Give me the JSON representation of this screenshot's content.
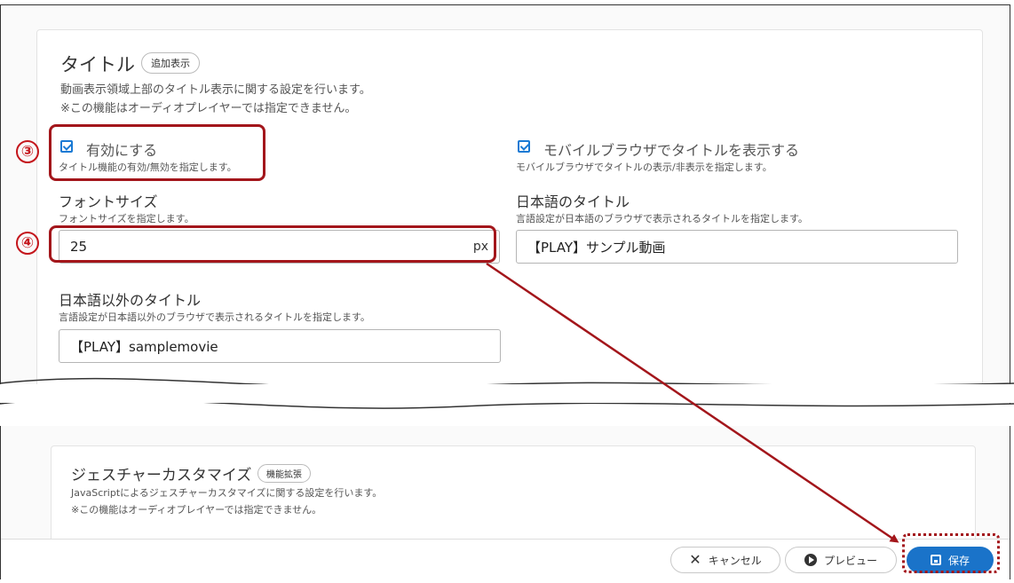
{
  "title_section": {
    "title": "タイトル",
    "badge": "追加表示",
    "desc1": "動画表示領域上部のタイトル表示に関する設定を行います。",
    "desc2": "※この機能はオーディオプレイヤーでは指定できません。"
  },
  "enable": {
    "label": "有効にする",
    "help": "タイトル機能の有効/無効を指定します。",
    "checked": true
  },
  "mobile": {
    "label": "モバイルブラウザでタイトルを表示する",
    "help": "モバイルブラウザでタイトルの表示/非表示を指定します。",
    "checked": true
  },
  "font_size": {
    "label": "フォントサイズ",
    "help": "フォントサイズを指定します。",
    "value": "25",
    "unit": "px"
  },
  "ja_title": {
    "label": "日本語のタイトル",
    "help": "言語設定が日本語のブラウザで表示されるタイトルを指定します。",
    "value": "【PLAY】サンプル動画"
  },
  "non_ja_title": {
    "label": "日本語以外のタイトル",
    "help": "言語設定が日本語以外のブラウザで表示されるタイトルを指定します。",
    "value": "【PLAY】samplemovie"
  },
  "gesture_section": {
    "title": "ジェスチャーカスタマイズ",
    "badge": "機能拡張",
    "desc1": "JavaScriptによるジェスチャーカスタマイズに関する設定を行います。",
    "desc2": "※この機能はオーディオプレイヤーでは指定できません。"
  },
  "annotations": {
    "step3": "③",
    "step4": "④"
  },
  "footer": {
    "cancel_label": "キャンセル",
    "preview_label": "プレビュー",
    "save_label": "保存"
  },
  "colors": {
    "accent": "#1a73c9",
    "annotation": "#a3161b"
  }
}
